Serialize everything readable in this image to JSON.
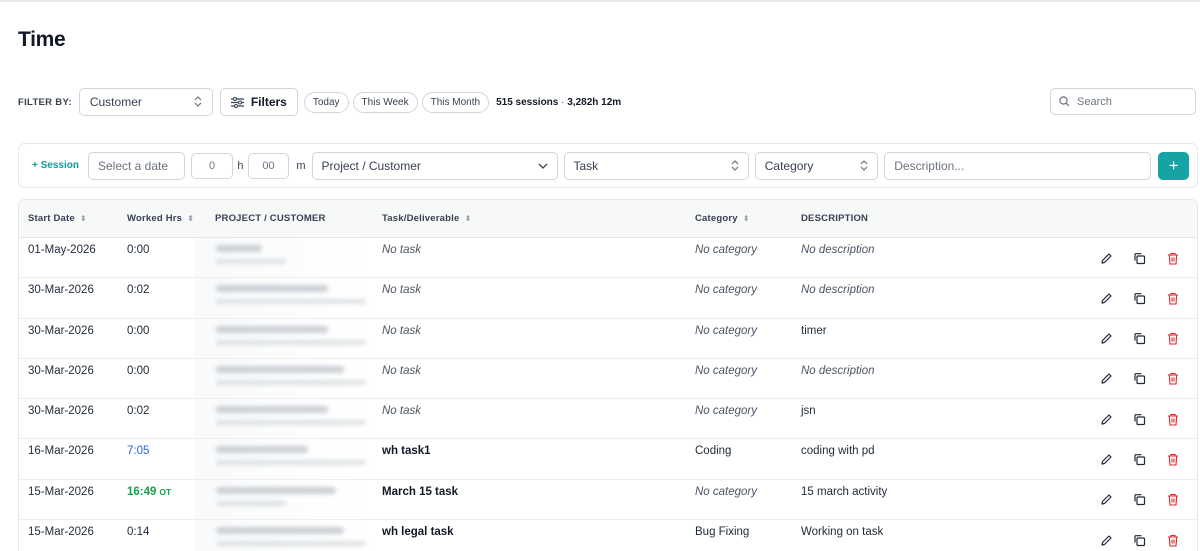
{
  "page": {
    "title": "Time"
  },
  "filterbar": {
    "label": "FILTER BY:",
    "customer_select": "Customer",
    "filters_button": "Filters",
    "quick_ranges": [
      "Today",
      "This Week",
      "This Month"
    ],
    "sessions_count": "515 sessions",
    "separator": " · ",
    "total_time": "3,282h 12m",
    "search_placeholder": "Search"
  },
  "entry": {
    "add_session_label": "+ Session",
    "date_placeholder": "Select a date",
    "hours_value": "0",
    "hours_unit": "h",
    "minutes_value": "00",
    "minutes_unit": "m",
    "project_placeholder": "Project / Customer",
    "task_placeholder": "Task",
    "category_placeholder": "Category",
    "description_placeholder": "Description...",
    "add_button_label": "+"
  },
  "table": {
    "columns": {
      "start_date": "Start Date",
      "worked_hrs": "Worked Hrs",
      "project": "PROJECT / CUSTOMER",
      "task": "Task/Deliverable",
      "category": "Category",
      "description": "DESCRIPTION"
    },
    "sort_glyph": "⬍",
    "rows": [
      {
        "date": "01-May-2026",
        "hours": "0:00",
        "hours_style": "normal",
        "ot": "",
        "task": "No task",
        "task_empty": true,
        "category": "No category",
        "category_empty": true,
        "description": "No description",
        "description_empty": true
      },
      {
        "date": "30-Mar-2026",
        "hours": "0:02",
        "hours_style": "normal",
        "ot": "",
        "task": "No task",
        "task_empty": true,
        "category": "No category",
        "category_empty": true,
        "description": "No description",
        "description_empty": true
      },
      {
        "date": "30-Mar-2026",
        "hours": "0:00",
        "hours_style": "normal",
        "ot": "",
        "task": "No task",
        "task_empty": true,
        "category": "No category",
        "category_empty": true,
        "description": "timer",
        "description_empty": false
      },
      {
        "date": "30-Mar-2026",
        "hours": "0:00",
        "hours_style": "normal",
        "ot": "",
        "task": "No task",
        "task_empty": true,
        "category": "No category",
        "category_empty": true,
        "description": "No description",
        "description_empty": true
      },
      {
        "date": "30-Mar-2026",
        "hours": "0:02",
        "hours_style": "normal",
        "ot": "",
        "task": "No task",
        "task_empty": true,
        "category": "No category",
        "category_empty": true,
        "description": "jsn",
        "description_empty": false
      },
      {
        "date": "16-Mar-2026",
        "hours": "7:05",
        "hours_style": "blue",
        "ot": "",
        "task": "wh task1",
        "task_empty": false,
        "category": "Coding",
        "category_empty": false,
        "description": "coding with pd",
        "description_empty": false
      },
      {
        "date": "15-Mar-2026",
        "hours": "16:49",
        "hours_style": "green",
        "ot": "OT",
        "task": "March 15 task",
        "task_empty": false,
        "category": "No category",
        "category_empty": true,
        "description": "15 march activity",
        "description_empty": false
      },
      {
        "date": "15-Mar-2026",
        "hours": "0:14",
        "hours_style": "normal",
        "ot": "",
        "task": "wh legal task",
        "task_empty": false,
        "category": "Bug Fixing",
        "category_empty": false,
        "description": "Working on task",
        "description_empty": false
      }
    ]
  },
  "colors": {
    "accent": "#16a3a3",
    "delete": "#dc2626",
    "blue_hours": "#2563eb",
    "green_hours": "#16a34a"
  },
  "icons": {
    "edit": "pencil-icon",
    "copy": "copy-icon",
    "delete": "trash-icon",
    "search": "search-icon",
    "filters": "sliders-icon"
  }
}
